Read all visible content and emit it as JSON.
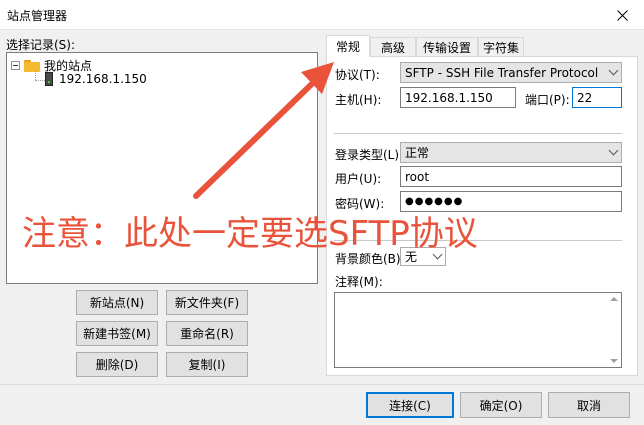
{
  "window": {
    "title": "站点管理器"
  },
  "left": {
    "label": "选择记录(S):",
    "tree": {
      "root_label": "我的站点",
      "children": [
        "192.168.1.150"
      ]
    },
    "buttons": {
      "new_site": "新站点(N)",
      "new_folder": "新文件夹(F)",
      "new_bookmark": "新建书签(M)",
      "rename": "重命名(R)",
      "delete": "删除(D)",
      "copy": "复制(I)"
    }
  },
  "tabs": [
    {
      "label": "常规",
      "active": true
    },
    {
      "label": "高级",
      "active": false
    },
    {
      "label": "传输设置",
      "active": false
    },
    {
      "label": "字符集",
      "active": false
    }
  ],
  "general": {
    "protocol_label": "协议(T):",
    "protocol_value": "SFTP - SSH File Transfer Protocol",
    "host_label": "主机(H):",
    "host_value": "192.168.1.150",
    "port_label": "端口(P):",
    "port_value": "22",
    "logon_type_label": "登录类型(L):",
    "logon_type_value": "正常",
    "user_label": "用户(U):",
    "user_value": "root",
    "password_label": "密码(W):",
    "password_value": "●●●●●●",
    "bg_color_label": "背景颜色(B)",
    "bg_color_value": "无",
    "notes_label": "注释(M):",
    "notes_value": ""
  },
  "footer": {
    "connect": "连接(C)",
    "ok": "确定(O)",
    "cancel": "取消"
  },
  "annotation": {
    "text": "注意：此处一定要选SFTP协议",
    "color": "#e9533b"
  },
  "icons": {
    "close": "close-icon",
    "folder": "folder-icon",
    "server": "server-icon",
    "dropdown": "chevron-down-icon"
  }
}
